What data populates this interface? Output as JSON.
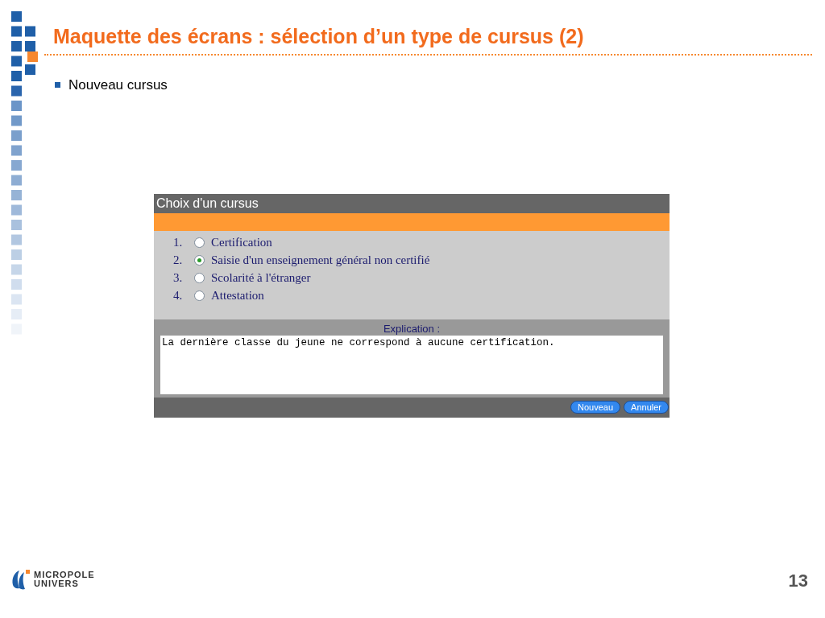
{
  "slide": {
    "title": "Maquette des écrans : sélection d’un type de cursus (2)",
    "bullets": [
      "Nouveau cursus"
    ],
    "page_number": "13",
    "logo": {
      "line_1": "MICROPOLE",
      "line_2": "UNIVERS"
    }
  },
  "dialog": {
    "title": "Choix d'un cursus",
    "options": [
      {
        "number": "1.",
        "label": "Certification",
        "selected": false
      },
      {
        "number": "2.",
        "label": "Saisie d'un enseignement général non certifié",
        "selected": true
      },
      {
        "number": "3.",
        "label": "Scolarité à l'étranger",
        "selected": false
      },
      {
        "number": "4.",
        "label": "Attestation",
        "selected": false
      }
    ],
    "explanation_label": "Explication :",
    "explanation_value": "La dernière classe du jeune ne correspond à aucune certification.",
    "buttons": [
      "Nouveau",
      "Annuler"
    ]
  }
}
